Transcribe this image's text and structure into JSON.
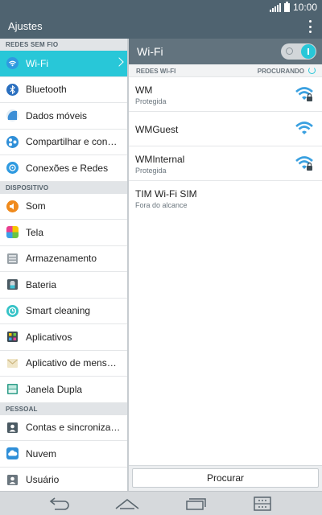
{
  "status": {
    "time": "10:00",
    "signal_icon": "signal-icon",
    "battery_icon": "battery-icon"
  },
  "appbar": {
    "title": "Ajustes",
    "menu_icon": "overflow-menu-icon"
  },
  "accent": "#28c7d8",
  "sidebar": {
    "sections": [
      {
        "title": "REDES SEM FIO",
        "items": [
          {
            "label": "Wi-Fi",
            "icon": "wifi-icon",
            "active": true
          },
          {
            "label": "Bluetooth",
            "icon": "bluetooth-icon"
          },
          {
            "label": "Dados móveis",
            "icon": "mobile-data-icon"
          },
          {
            "label": "Compartilhar e conectar",
            "icon": "share-connect-icon"
          },
          {
            "label": "Conexões e Redes",
            "icon": "networks-icon"
          }
        ]
      },
      {
        "title": "DISPOSITIVO",
        "items": [
          {
            "label": "Som",
            "icon": "sound-icon"
          },
          {
            "label": "Tela",
            "icon": "display-icon"
          },
          {
            "label": "Armazenamento",
            "icon": "storage-icon"
          },
          {
            "label": "Bateria",
            "icon": "battery-settings-icon"
          },
          {
            "label": "Smart cleaning",
            "icon": "smart-cleaning-icon"
          },
          {
            "label": "Aplicativos",
            "icon": "apps-icon"
          },
          {
            "label": "Aplicativo de mensagens",
            "icon": "messaging-icon"
          },
          {
            "label": "Janela Dupla",
            "icon": "dual-window-icon"
          }
        ]
      },
      {
        "title": "PESSOAL",
        "items": [
          {
            "label": "Contas e sincronização",
            "icon": "accounts-sync-icon"
          },
          {
            "label": "Nuvem",
            "icon": "cloud-icon"
          },
          {
            "label": "Usuário",
            "icon": "user-icon"
          }
        ]
      }
    ]
  },
  "wifi_panel": {
    "title": "Wi-Fi",
    "toggle_on": true,
    "section_label": "REDES WI-FI",
    "scanning_label": "PROCURANDO",
    "networks": [
      {
        "name": "WM",
        "status": "Protegida",
        "icon": "wifi-locked-icon"
      },
      {
        "name": "WMGuest",
        "status": "",
        "icon": "wifi-signal-icon"
      },
      {
        "name": "WMInternal",
        "status": "Protegida",
        "icon": "wifi-locked-icon"
      },
      {
        "name": "TIM Wi-Fi SIM",
        "status": "Fora do alcance",
        "icon": ""
      }
    ],
    "scan_button": "Procurar"
  },
  "navbar": {
    "back_icon": "back-icon",
    "home_icon": "home-icon",
    "recents_icon": "recent-apps-icon",
    "menu_icon": "menu-icon"
  }
}
